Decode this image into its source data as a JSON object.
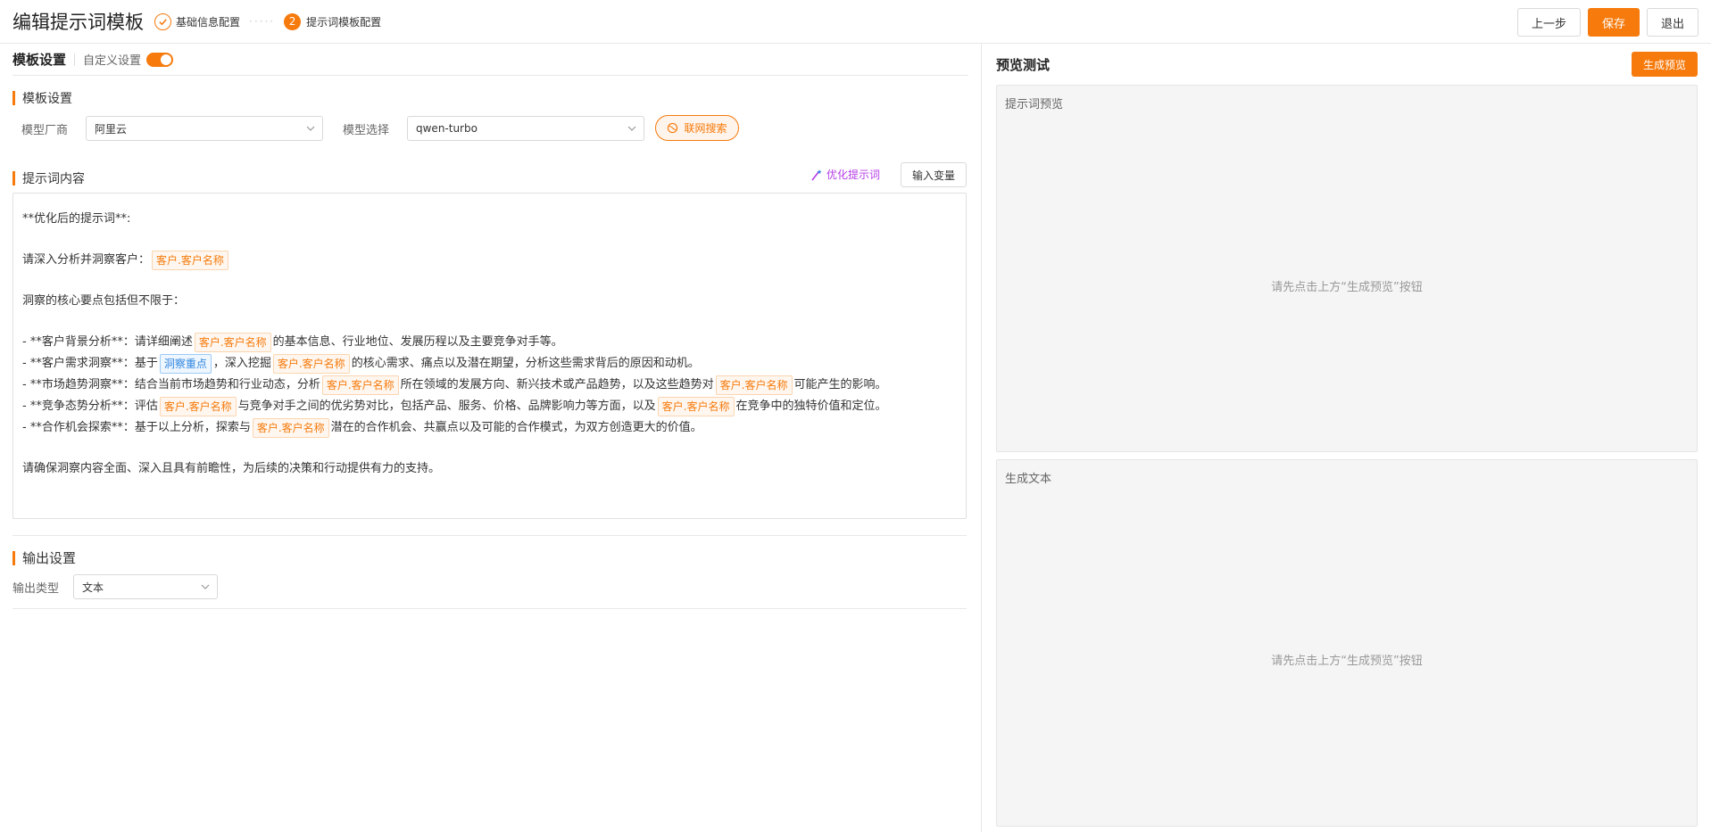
{
  "header": {
    "title": "编辑提示词模板",
    "step1_label": "基础信息配置",
    "step2_number": "2",
    "step2_label": "提示词模板配置",
    "prev_label": "上一步",
    "save_label": "保存",
    "exit_label": "退出",
    "accent_color": "#f67a0c"
  },
  "template": {
    "title": "模板设置",
    "custom_label": "自定义设置",
    "custom_enabled": true,
    "model_section_title": "模板设置",
    "vendor_label": "模型厂商",
    "vendor_value": "阿里云",
    "model_label": "模型选择",
    "model_value": "qwen-turbo",
    "web_search_label": "联网搜索",
    "prompt_section_title": "提示词内容",
    "optimize_label": "优化提示词",
    "input_var_label": "输入变量"
  },
  "prompt": {
    "heading": "**优化后的提示词**:",
    "intro": "请深入分析并洞察客户：",
    "var_customer": "客户.客户名称",
    "var_focus": "洞察重点",
    "core_intro": "洞察的核心要点包括但不限于：",
    "b1_a": "- **客户背景分析**：请详细阐述",
    "b1_b": "的基本信息、行业地位、发展历程以及主要竞争对手等。",
    "b2_a": "- **客户需求洞察**：基于",
    "b2_b": "，深入挖掘",
    "b2_c": "的核心需求、痛点以及潜在期望，分析这些需求背后的原因和动机。",
    "b3_a": "- **市场趋势洞察**：结合当前市场趋势和行业动态，分析",
    "b3_b": "所在领域的发展方向、新兴技术或产品趋势，以及这些趋势对",
    "b3_c": "可能产生的影响。",
    "b4_a": "- **竞争态势分析**：评估",
    "b4_b": "与竞争对手之间的优劣势对比，包括产品、服务、价格、品牌影响力等方面，以及",
    "b4_c": "在竞争中的独特价值和定位。",
    "b5_a": "- **合作机会探索**：基于以上分析，探索与",
    "b5_b": "潜在的合作机会、共赢点以及可能的合作模式，为双方创造更大的价值。",
    "closing": "请确保洞察内容全面、深入且具有前瞻性，为后续的决策和行动提供有力的支持。"
  },
  "output": {
    "section_title": "输出设置",
    "type_label": "输出类型",
    "type_value": "文本"
  },
  "preview": {
    "title": "预览测试",
    "generate_label": "生成预览",
    "prompt_preview_label": "提示词预览",
    "generated_text_label": "生成文本",
    "hint": "请先点击上方“生成预览”按钮"
  }
}
